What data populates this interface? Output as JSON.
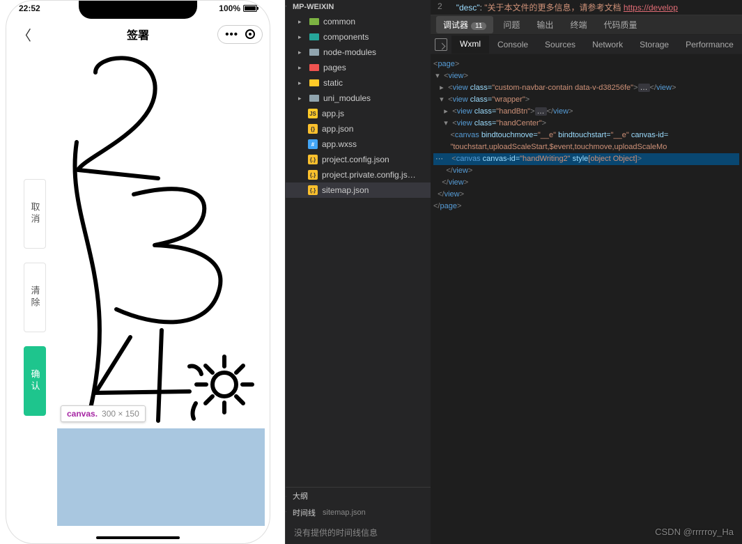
{
  "simulator": {
    "status_time": "22:52",
    "battery_pct": "100%",
    "page_title": "签署",
    "buttons": {
      "cancel": "取消",
      "clear": "清除",
      "confirm": "确认"
    },
    "tooltip": {
      "tag": "canvas.",
      "dim": "300 × 150"
    }
  },
  "tree": {
    "root": "MP-WEIXIN",
    "folders": [
      {
        "name": "common",
        "color": "fi-green"
      },
      {
        "name": "components",
        "color": "fi-teal"
      },
      {
        "name": "node-modules",
        "color": "fi-grey"
      },
      {
        "name": "pages",
        "color": "fi-red"
      },
      {
        "name": "static",
        "color": "fi-yellow"
      },
      {
        "name": "uni_modules",
        "color": "fi-grey"
      }
    ],
    "files": [
      {
        "name": "app.js",
        "icon": "js-icon",
        "label": "JS"
      },
      {
        "name": "app.json",
        "icon": "json-icon",
        "label": "{}"
      },
      {
        "name": "app.wxss",
        "icon": "css-icon",
        "label": "#"
      },
      {
        "name": "project.config.json",
        "icon": "json-icon",
        "label": "{.}"
      },
      {
        "name": "project.private.config.js…",
        "icon": "json-icon",
        "label": "{.}"
      },
      {
        "name": "sitemap.json",
        "icon": "json-icon",
        "label": "{.}"
      }
    ],
    "outline": "大纲",
    "timeline": "时间线",
    "timeline_file": "sitemap.json",
    "timeline_empty": "没有提供的时间线信息"
  },
  "editor": {
    "line_no": "2",
    "key": "\"desc\"",
    "val_prefix": "\"关于本文件的更多信息，请参考文档 ",
    "val_link": "https://develop"
  },
  "debugger": {
    "tabs": [
      "调试器",
      "问题",
      "输出",
      "终端",
      "代码质量"
    ],
    "badge": "11"
  },
  "tooltabs": [
    "Wxml",
    "Console",
    "Sources",
    "Network",
    "Storage",
    "Performance"
  ],
  "dom": {
    "l0": "<page>",
    "l1": "<view>",
    "l2_attr": "class=",
    "l2_val": "\"custom-navbar-contain data-v-d38256fe\"",
    "l2_close": "</view>",
    "l3_attr": "class=",
    "l3_val": "\"wrapper\"",
    "l4_attr": "class=",
    "l4_val": "\"handBtn\"",
    "l4_close": "</view>",
    "l5_attr": "class=",
    "l5_val": "\"handCenter\"",
    "l6_a": "bindtouchmove=",
    "l6_av": "\"__e\"",
    "l6_b": "bindtouchstart=",
    "l6_bv": "\"__e\"",
    "l6_c": "canvas-id=",
    "l7": "\"touchstart,uploadScaleStart,$event,touchmove,uploadScaleMo",
    "l8_a": "canvas-id=",
    "l8_av": "\"handWriting2\"",
    "l8_b": "style",
    "l8_bv": "[object Object]",
    "c_view": "</view>",
    "c_page": "</page>",
    "tag_page": "page",
    "tag_view": "view",
    "tag_canvas": "canvas"
  },
  "watermark": "CSDN @rrrrroy_Ha"
}
